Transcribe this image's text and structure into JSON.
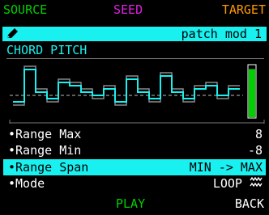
{
  "tabs": {
    "source": "SOURCE",
    "seed": "SEED",
    "target": "TARGET"
  },
  "header": {
    "patch_name": "patch mod 1",
    "icon": "pencil-icon"
  },
  "section_title": "CHORD PITCH",
  "graph": {
    "steps_bright": [
      -2,
      8,
      1,
      -1,
      4,
      3,
      1,
      0,
      2,
      -2,
      5,
      1,
      -1,
      6,
      1,
      -1,
      2,
      3,
      0,
      2
    ],
    "steps_shadow": [
      -3,
      9,
      2,
      -2,
      5,
      4,
      2,
      -1,
      3,
      -3,
      6,
      2,
      -2,
      7,
      2,
      -2,
      3,
      4,
      -1,
      3
    ],
    "level": 0.93
  },
  "params": [
    {
      "label": "•Range Max",
      "value": "8"
    },
    {
      "label": "•Range Min",
      "value": "-8"
    },
    {
      "label": "•Range Span",
      "value": "MIN -> MAX",
      "selected": true
    },
    {
      "label": "•Mode",
      "value": "LOOP",
      "value_icon": "loop-wave-icon"
    }
  ],
  "footer": {
    "play": "PLAY",
    "back": "BACK"
  },
  "colors": {
    "cyan": "#19f0f0",
    "green": "#00d000",
    "magenta": "#e020e0",
    "orange": "#ff9a00"
  }
}
